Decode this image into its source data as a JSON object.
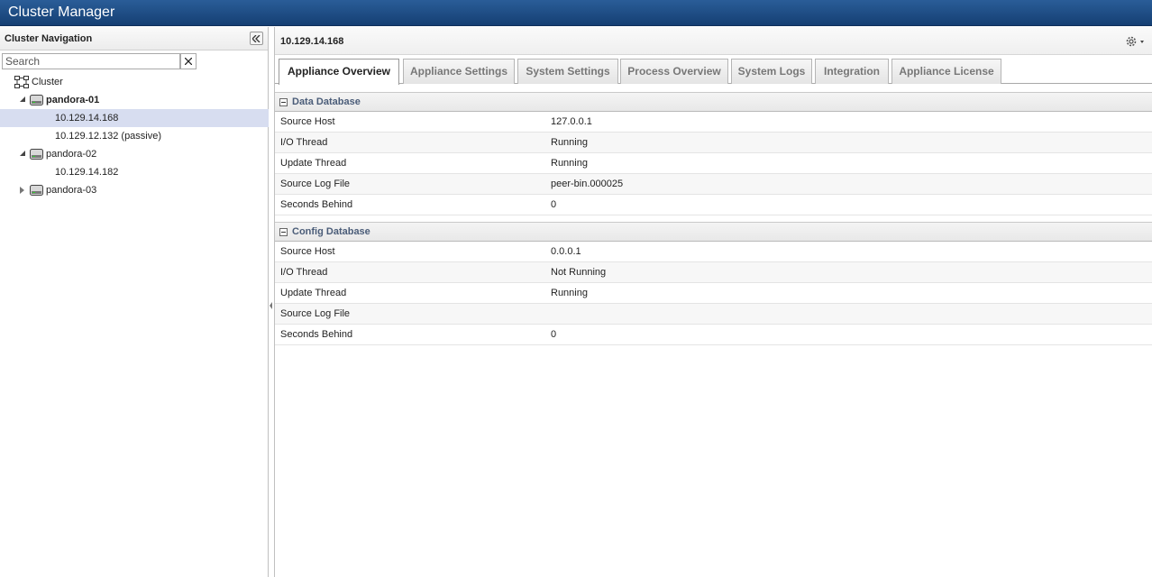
{
  "app": {
    "title": "Cluster Manager"
  },
  "nav": {
    "title": "Cluster Navigation",
    "search": {
      "placeholder": "Search",
      "value": ""
    },
    "tree": {
      "root": "Cluster",
      "nodes": [
        {
          "label": "pandora-01",
          "expanded": true,
          "children": [
            "10.129.14.168",
            "10.129.12.132 (passive)"
          ]
        },
        {
          "label": "pandora-02",
          "expanded": true,
          "children": [
            "10.129.14.182"
          ]
        },
        {
          "label": "pandora-03",
          "expanded": false,
          "children": []
        }
      ],
      "selected": "10.129.14.168"
    }
  },
  "main": {
    "title": "10.129.14.168",
    "tabs": [
      {
        "label": "Appliance Overview",
        "active": true
      },
      {
        "label": "Appliance Settings",
        "active": false
      },
      {
        "label": "System Settings",
        "active": false
      },
      {
        "label": "Process Overview",
        "active": false
      },
      {
        "label": "System Logs",
        "active": false
      },
      {
        "label": "Integration",
        "active": false
      },
      {
        "label": "Appliance License",
        "active": false
      }
    ],
    "sections": [
      {
        "title": "Data Database",
        "rows": [
          {
            "key": "Source Host",
            "value": "127.0.0.1"
          },
          {
            "key": "I/O Thread",
            "value": "Running"
          },
          {
            "key": "Update Thread",
            "value": "Running"
          },
          {
            "key": "Source Log File",
            "value": "peer-bin.000025"
          },
          {
            "key": "Seconds Behind",
            "value": "0"
          }
        ]
      },
      {
        "title": "Config Database",
        "rows": [
          {
            "key": "Source Host",
            "value": "0.0.0.1"
          },
          {
            "key": "I/O Thread",
            "value": "Not Running"
          },
          {
            "key": "Update Thread",
            "value": "Running"
          },
          {
            "key": "Source Log File",
            "value": ""
          },
          {
            "key": "Seconds Behind",
            "value": "0"
          }
        ]
      }
    ]
  },
  "icons": {
    "collapse": "double-chevron-left-icon",
    "clear": "close-icon",
    "cluster": "cluster-icon",
    "server": "server-icon",
    "settings": "gear-icon"
  },
  "colors": {
    "titlebar": "#1f4f87",
    "selected_row": "#d7ddf0",
    "section_title": "#4a5c78"
  }
}
